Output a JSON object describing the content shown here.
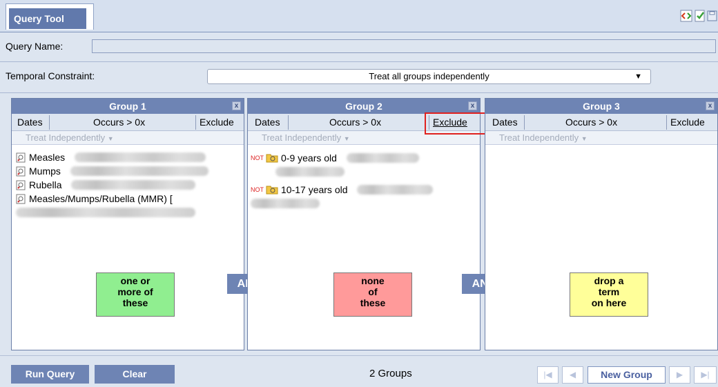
{
  "tab": {
    "title": "Query Tool"
  },
  "toolbar_icons": [
    "code-icon",
    "check-icon",
    "save-icon"
  ],
  "query_name": {
    "label": "Query Name:",
    "value": ""
  },
  "temporal": {
    "label": "Temporal Constraint:",
    "value": "Treat all groups independently"
  },
  "groups": [
    {
      "title": "Group 1",
      "close": "x",
      "dates": "Dates",
      "occurs": "Occurs > 0x",
      "exclude": "Exclude",
      "treat": "Treat Independently",
      "items": [
        "Measles",
        "Mumps",
        "Rubella",
        "Measles/Mumps/Rubella (MMR) ["
      ],
      "sticky": "one or\nmore of\nthese",
      "sticky_color": "#90ee90"
    },
    {
      "title": "Group 2",
      "close": "x",
      "dates": "Dates",
      "occurs": "Occurs > 0x",
      "exclude": "Exclude",
      "treat": "Treat Independently",
      "not_label": "NOT",
      "items": [
        "0-9 years old",
        "10-17 years old"
      ],
      "sticky": "none\nof\nthese",
      "sticky_color": "#ff9a9a"
    },
    {
      "title": "Group 3",
      "close": "x",
      "dates": "Dates",
      "occurs": "Occurs > 0x",
      "exclude": "Exclude",
      "treat": "Treat Independently",
      "sticky": "drop a\nterm\non here",
      "sticky_color": "#ffff99"
    }
  ],
  "and_label": "AND",
  "footer": {
    "run_query": "Run Query",
    "clear": "Clear",
    "status": "2 Groups",
    "new_group": "New Group"
  },
  "colors": {
    "header_blue": "#6e84b4",
    "panel_bg": "#dde5f0",
    "highlight_red": "#e0201e"
  }
}
